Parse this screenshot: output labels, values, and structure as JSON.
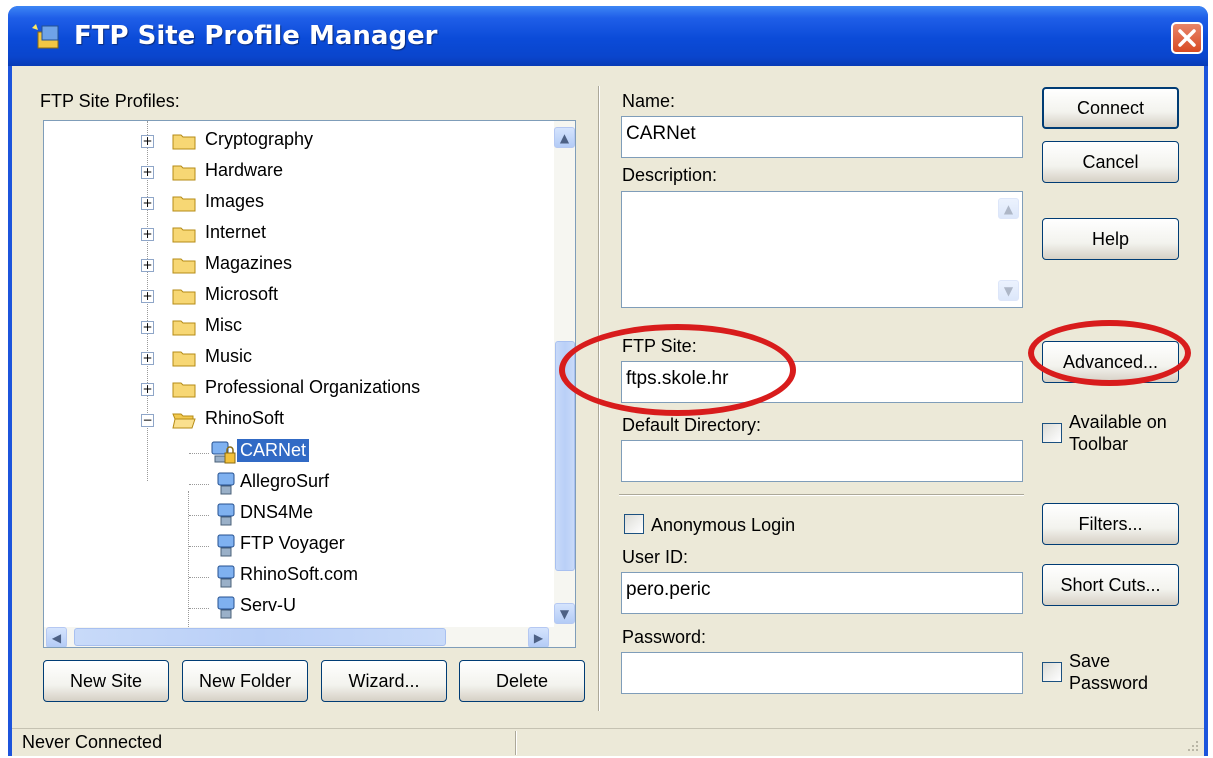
{
  "window": {
    "title": "FTP Site Profile Manager"
  },
  "tree": {
    "label": "FTP Site Profiles:",
    "folders": [
      {
        "label": "Cryptography"
      },
      {
        "label": "Hardware"
      },
      {
        "label": "Images"
      },
      {
        "label": "Internet"
      },
      {
        "label": "Magazines"
      },
      {
        "label": "Microsoft"
      },
      {
        "label": "Misc"
      },
      {
        "label": "Music"
      },
      {
        "label": "Professional Organizations"
      },
      {
        "label": "RhinoSoft"
      }
    ],
    "sites": [
      {
        "label": "CARNet",
        "selected": true
      },
      {
        "label": "AllegroSurf"
      },
      {
        "label": "DNS4Me"
      },
      {
        "label": "FTP Voyager"
      },
      {
        "label": "RhinoSoft.com"
      },
      {
        "label": "Serv-U"
      }
    ]
  },
  "bottom_buttons": {
    "new_site": "New Site",
    "new_folder": "New Folder",
    "wizard": "Wizard...",
    "delete": "Delete"
  },
  "form": {
    "name_label": "Name:",
    "name_value": "CARNet",
    "description_label": "Description:",
    "description_value": "",
    "ftp_site_label": "FTP Site:",
    "ftp_site_value": "ftps.skole.hr",
    "default_dir_label": "Default Directory:",
    "default_dir_value": "",
    "anonymous_label": "Anonymous Login",
    "user_id_label": "User ID:",
    "user_id_value": "pero.peric",
    "password_label": "Password:",
    "password_value": ""
  },
  "right_buttons": {
    "connect": "Connect",
    "cancel": "Cancel",
    "help": "Help",
    "advanced": "Advanced...",
    "filters": "Filters...",
    "short_cuts": "Short Cuts..."
  },
  "options": {
    "available_on_toolbar_1": "Available on",
    "available_on_toolbar_2": "Toolbar",
    "save_password_1": "Save",
    "save_password_2": "Password"
  },
  "status": {
    "text": "Never Connected"
  },
  "colors": {
    "titlebar": "#0b4bd8",
    "selection": "#316ac5",
    "annotation": "#d81c1c",
    "dialog_bg": "#ece9d8"
  }
}
